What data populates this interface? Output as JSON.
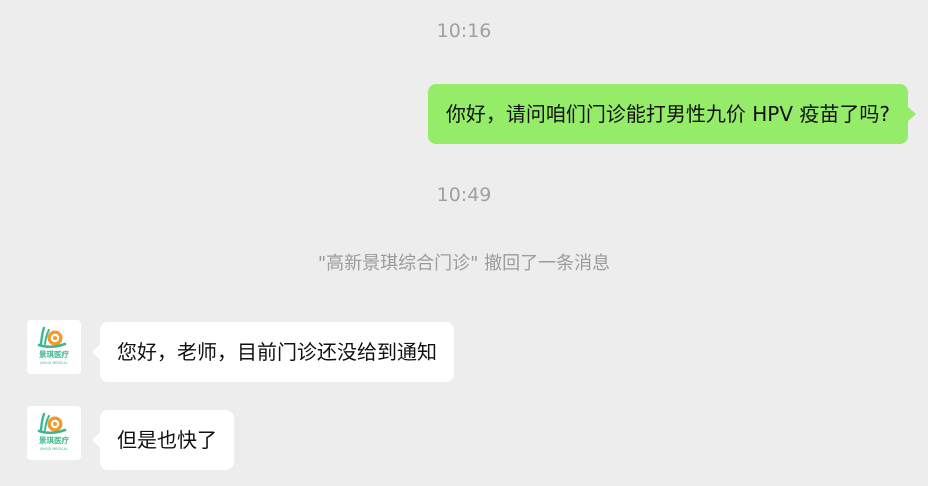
{
  "chat": {
    "timestamp_1": "10:16",
    "timestamp_2": "10:49",
    "recall_notice": "\"高新景琪综合门诊\" 撤回了一条消息",
    "messages": [
      {
        "direction": "out",
        "text": "你好，请问咱们门诊能打男性九价 HPV 疫苗了吗?"
      },
      {
        "direction": "in",
        "text": "您好，老师，目前门诊还没给到通知"
      },
      {
        "direction": "in",
        "text": "但是也快了"
      }
    ]
  },
  "contact": {
    "avatar_label": "景琪医疗",
    "avatar_subtitle": "JINGQI MEDICAL",
    "icon": "snail-logo-icon",
    "brand_colors": {
      "green": "#3DB88A",
      "orange": "#F39A2B"
    }
  },
  "colors": {
    "background": "#EDEDED",
    "outgoing_bubble": "#95EC69",
    "incoming_bubble": "#FFFFFF",
    "meta_text": "#A0A0A0"
  }
}
